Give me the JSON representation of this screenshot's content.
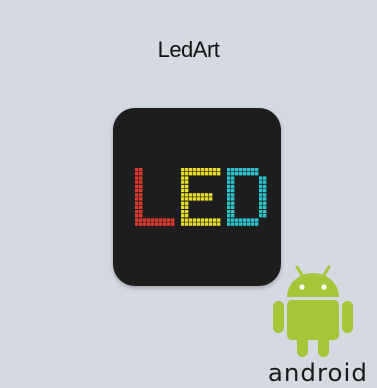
{
  "app": {
    "title": "LedArt",
    "icon_text": "LED",
    "icon_colors": {
      "L": "#e23b2e",
      "E": "#e6dc2a",
      "D": "#2cc4cf",
      "background": "#1d1d1d"
    }
  },
  "badge": {
    "icon": "android-robot-icon",
    "wordmark": "android",
    "color": "#a4c639"
  },
  "colors": {
    "card_background": "#d5d9e2"
  }
}
